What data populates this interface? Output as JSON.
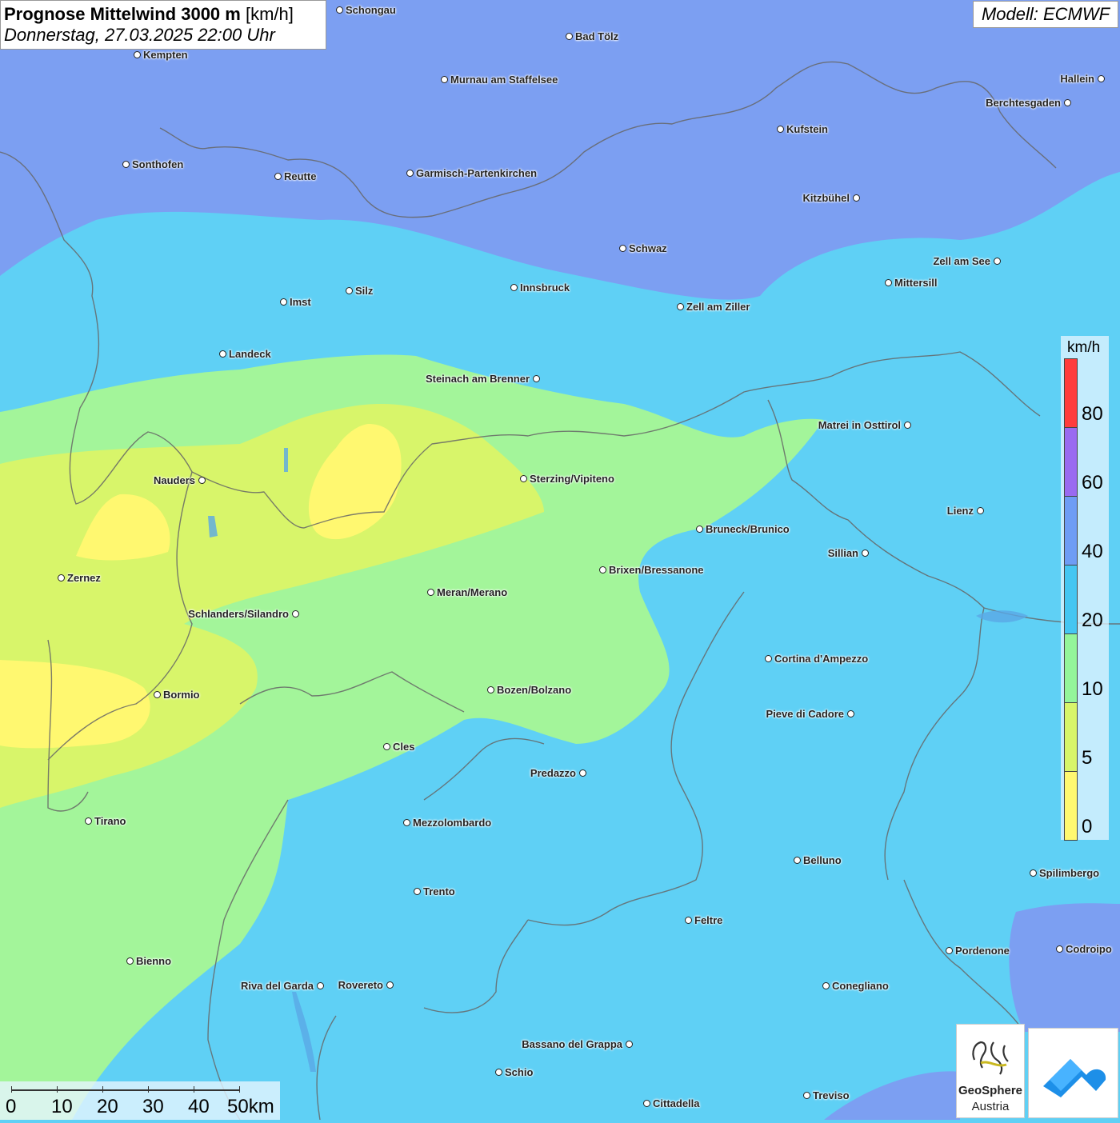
{
  "header": {
    "title_bold": "Prognose Mittelwind 3000 m",
    "title_unit": "[km/h]",
    "subtitle": "Donnerstag, 27.03.2025 22:00 Uhr",
    "model": "Modell: ECMWF"
  },
  "legend": {
    "unit": "km/h",
    "labels": [
      "80",
      "60",
      "40",
      "20",
      "10",
      "5",
      "0"
    ],
    "colors": [
      "#ff3c3c",
      "#9a6af0",
      "#6e9cf5",
      "#45c6f2",
      "#94f59a",
      "#d8f56a",
      "#fff870"
    ]
  },
  "scale_bar": {
    "labels": [
      "0",
      "10",
      "20",
      "30",
      "40",
      "50km"
    ]
  },
  "cities": [
    {
      "name": "Schongau"
    },
    {
      "name": "Bad Tölz"
    },
    {
      "name": "Kempten"
    },
    {
      "name": "Murnau am Staffelsee"
    },
    {
      "name": "Hallein"
    },
    {
      "name": "Berchtesgaden"
    },
    {
      "name": "Kufstein"
    },
    {
      "name": "Sonthofen"
    },
    {
      "name": "Reutte"
    },
    {
      "name": "Garmisch-Partenkirchen"
    },
    {
      "name": "Kitzbühel"
    },
    {
      "name": "Schwaz"
    },
    {
      "name": "Zell am See"
    },
    {
      "name": "Mittersill"
    },
    {
      "name": "Innsbruck"
    },
    {
      "name": "Silz"
    },
    {
      "name": "Imst"
    },
    {
      "name": "Zell am Ziller"
    },
    {
      "name": "Landeck"
    },
    {
      "name": "Steinach am Brenner"
    },
    {
      "name": "Matrei in Osttirol"
    },
    {
      "name": "Nauders"
    },
    {
      "name": "Sterzing/Vipiteno"
    },
    {
      "name": "Lienz"
    },
    {
      "name": "Bruneck/Brunico"
    },
    {
      "name": "Sillian"
    },
    {
      "name": "Zernez"
    },
    {
      "name": "Brixen/Bressanone"
    },
    {
      "name": "Meran/Merano"
    },
    {
      "name": "Schlanders/Silandro"
    },
    {
      "name": "Cortina d'Ampezzo"
    },
    {
      "name": "Bozen/Bolzano"
    },
    {
      "name": "Bormio"
    },
    {
      "name": "Pieve di Cadore"
    },
    {
      "name": "Cles"
    },
    {
      "name": "Predazzo"
    },
    {
      "name": "Tirano"
    },
    {
      "name": "Mezzolombardo"
    },
    {
      "name": "Belluno"
    },
    {
      "name": "Spilimbergo"
    },
    {
      "name": "Trento"
    },
    {
      "name": "Feltre"
    },
    {
      "name": "Pordenone"
    },
    {
      "name": "Codroipo"
    },
    {
      "name": "Bienno"
    },
    {
      "name": "Riva del Garda"
    },
    {
      "name": "Rovereto"
    },
    {
      "name": "Conegliano"
    },
    {
      "name": "Bassano del Grappa"
    },
    {
      "name": "Schio"
    },
    {
      "name": "Treviso"
    },
    {
      "name": "Cittadella"
    }
  ],
  "logos": {
    "geosphere_line1": "GeoSphere",
    "geosphere_line2": "Austria"
  }
}
